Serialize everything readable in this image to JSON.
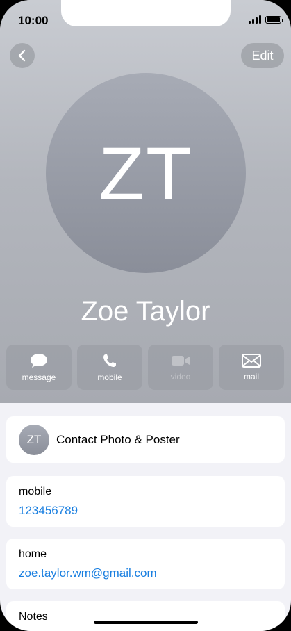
{
  "status_bar": {
    "time": "10:00"
  },
  "nav": {
    "edit_label": "Edit"
  },
  "contact": {
    "initials": "ZT",
    "name": "Zoe Taylor"
  },
  "actions": [
    {
      "label": "message",
      "icon": "message-bubble-icon",
      "enabled": true
    },
    {
      "label": "mobile",
      "icon": "phone-icon",
      "enabled": true
    },
    {
      "label": "video",
      "icon": "video-camera-icon",
      "enabled": false
    },
    {
      "label": "mail",
      "icon": "envelope-icon",
      "enabled": true
    }
  ],
  "poster": {
    "initials": "ZT",
    "label": "Contact Photo & Poster"
  },
  "fields": {
    "mobile": {
      "label": "mobile",
      "value": "123456789"
    },
    "home": {
      "label": "home",
      "value": "zoe.taylor.wm@gmail.com"
    },
    "notes": {
      "label": "Notes"
    }
  },
  "colors": {
    "link": "#1a7fe0",
    "hero_bg": "#b3b6bd"
  }
}
